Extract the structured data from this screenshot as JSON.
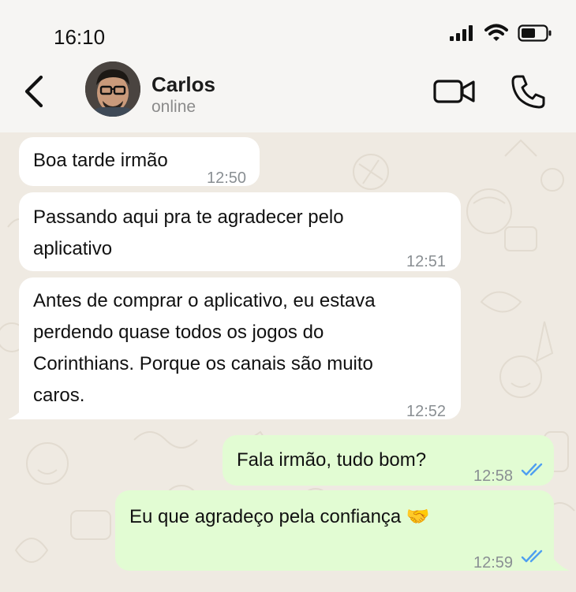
{
  "status_bar": {
    "time": "16:10"
  },
  "header": {
    "name": "Carlos",
    "status": "online"
  },
  "messages": [
    {
      "from": "contact",
      "lines": [
        "Boa tarde irmão"
      ],
      "time": "12:50"
    },
    {
      "from": "contact",
      "lines": [
        "Passando aqui pra te agradecer pelo",
        "aplicativo"
      ],
      "time": "12:51"
    },
    {
      "from": "contact",
      "lines": [
        "Antes de comprar o aplicativo, eu estava",
        "perdendo quase todos os jogos do",
        "Corinthians. Porque os canais são muito",
        "caros."
      ],
      "time": "12:52"
    },
    {
      "from": "me",
      "lines": [
        "Fala irmão, tudo bom?"
      ],
      "time": "12:58",
      "read": true
    },
    {
      "from": "me",
      "lines": [
        "Eu que agradeço pela confiança 🤝"
      ],
      "time": "12:59",
      "read": true
    }
  ],
  "colors": {
    "incoming_bubble": "#ffffff",
    "outgoing_bubble": "#e2fcd3",
    "read_ticks": "#4f9ff0",
    "wallpaper": "#efeae2"
  },
  "icons": [
    "signal-icon",
    "wifi-icon",
    "battery-icon",
    "back-arrow-icon",
    "video-call-icon",
    "phone-call-icon",
    "double-check-icon"
  ]
}
